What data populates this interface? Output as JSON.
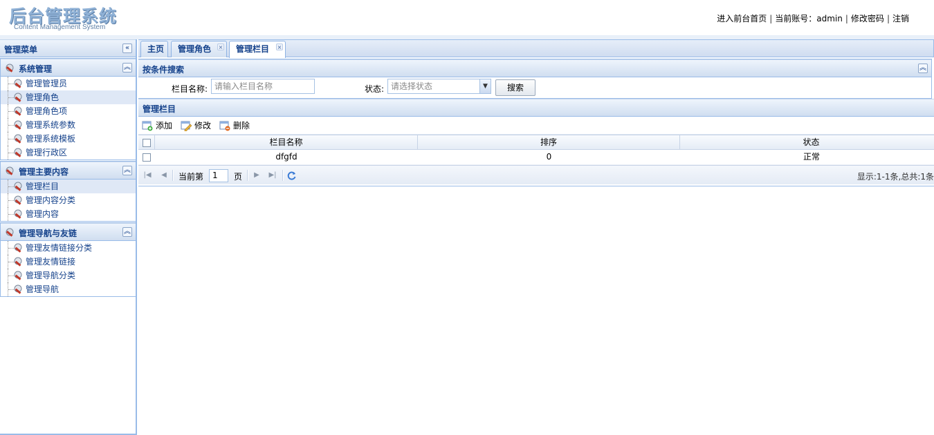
{
  "header": {
    "logo_title": "后台管理系统",
    "logo_subtitle": "Content Management System",
    "links": [
      "进入前台首页",
      "当前账号：admin",
      "修改密码",
      "注销"
    ]
  },
  "sidebar": {
    "title": "管理菜单",
    "collapse_icon": "double-chevron-left-icon",
    "groups": [
      {
        "title": "系统管理",
        "items": [
          "管理管理员",
          "管理角色",
          "管理角色项",
          "管理系统参数",
          "管理系统模板",
          "管理行政区"
        ]
      },
      {
        "title": "管理主要内容",
        "items": [
          "管理栏目",
          "管理内容分类",
          "管理内容"
        ]
      },
      {
        "title": "管理导航与友链",
        "items": [
          "管理友情链接分类",
          "管理友情链接",
          "管理导航分类",
          "管理导航"
        ]
      }
    ],
    "selected_item": "管理栏目"
  },
  "tabs": [
    {
      "label": "主页",
      "closable": false
    },
    {
      "label": "管理角色",
      "closable": true
    },
    {
      "label": "管理栏目",
      "closable": true,
      "active": true
    }
  ],
  "search": {
    "title": "按条件搜索",
    "name_label": "栏目名称:",
    "name_placeholder": "请输入栏目名称",
    "status_label": "状态:",
    "status_placeholder": "请选择状态",
    "button": "搜索"
  },
  "grid": {
    "title": "管理栏目",
    "toolbar": [
      "添加",
      "修改",
      "删除"
    ],
    "columns": [
      "栏目名称",
      "排序",
      "状态"
    ],
    "rows": [
      {
        "name": "dfgfd",
        "order": "0",
        "status": "正常"
      }
    ],
    "pager": {
      "before": "当前第",
      "page": "1",
      "after": "页",
      "info": "显示:1-1条,总共:1条"
    }
  },
  "colors": {
    "accent": "#15428b",
    "border": "#99bbe8",
    "header_bg": "#d0def0"
  }
}
